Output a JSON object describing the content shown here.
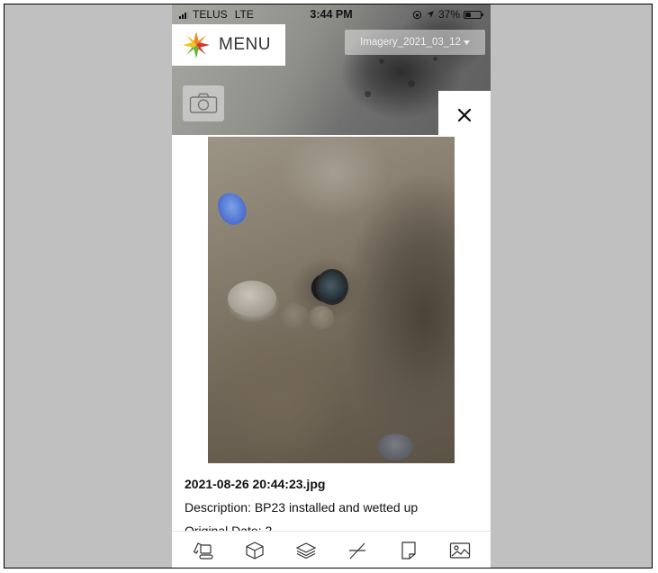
{
  "status_bar": {
    "carrier": "TELUS",
    "network": "LTE",
    "time": "3:44 PM",
    "battery_percent": "37%",
    "battery_level": 0.37
  },
  "header": {
    "menu_label": "MENU",
    "imagery_select_value": "Imagery_2021_03_12"
  },
  "photo_detail": {
    "filename": "2021-08-26 20:44:23.jpg",
    "description_label": "Description:",
    "description_value": "BP23 installed and wetted up",
    "original_date_label": "Original Date: 2..."
  },
  "toolbar": {
    "tools": [
      {
        "icon": "excavator-icon"
      },
      {
        "icon": "cube-icon"
      },
      {
        "icon": "layers-icon"
      },
      {
        "icon": "measure-icon"
      },
      {
        "icon": "note-icon"
      },
      {
        "icon": "image-icon"
      }
    ]
  },
  "colors": {
    "frame_bg": "#c0c0c0",
    "logo_orange": "#f08a24",
    "logo_red": "#d9342b",
    "logo_green": "#6cb33f",
    "logo_yellow": "#f6c21c"
  }
}
